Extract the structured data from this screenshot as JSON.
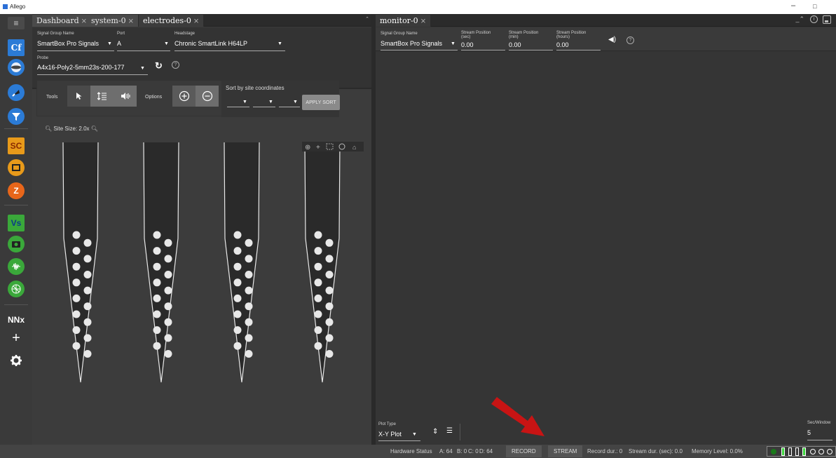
{
  "window": {
    "title": "Allego",
    "minimize": "–",
    "maximize": "□"
  },
  "launcher": {
    "items": [
      {
        "name": "cf",
        "label": "Cf",
        "color": "#2b7bd6"
      },
      {
        "name": "sphere",
        "label": "",
        "color": "#2b7bd6"
      },
      {
        "name": "rocket",
        "label": "",
        "color": "#2b7bd6"
      },
      {
        "name": "funnel",
        "label": "",
        "color": "#2b7bd6"
      },
      {
        "name": "sc",
        "label": "SC",
        "color": "#e89a1a"
      },
      {
        "name": "screen",
        "label": "",
        "color": "#e89a1a"
      },
      {
        "name": "z",
        "label": "Z",
        "color": "#e8661a"
      },
      {
        "name": "vs",
        "label": "Vs",
        "color": "#3aa83a"
      },
      {
        "name": "camera",
        "label": "",
        "color": "#3aa83a"
      },
      {
        "name": "wave",
        "label": "",
        "color": "#3aa83a"
      },
      {
        "name": "grid",
        "label": "",
        "color": "#3aa83a"
      },
      {
        "name": "nnx",
        "label": "NNx",
        "color": ""
      },
      {
        "name": "plus",
        "label": "+",
        "color": ""
      },
      {
        "name": "gear",
        "label": "",
        "color": ""
      }
    ]
  },
  "left_panel": {
    "tabs": [
      {
        "label": "Dashboard",
        "close": "×"
      },
      {
        "label": "system-0",
        "close": "×"
      },
      {
        "label": "electrodes-0",
        "close": "×"
      }
    ],
    "signal_group": {
      "label": "Signal Group Name",
      "value": "SmartBox Pro Signals"
    },
    "port": {
      "label": "Port",
      "value": "A"
    },
    "headstage": {
      "label": "Headstage",
      "value": "Chronic SmartLink H64LP"
    },
    "probe": {
      "label": "Probe",
      "value": "A4x16-Poly2-5mm23s-200-177"
    },
    "tools_label": "Tools",
    "options_label": "Options",
    "sort_label": "Sort by site coordinates",
    "apply_sort": "APPLY SORT",
    "site_size": "Site Size: 2.0x",
    "probes": {
      "shanks": 4,
      "sites_per_shank": 16
    }
  },
  "right_panel": {
    "tabs": [
      {
        "label": "monitor-0",
        "close": "×"
      }
    ],
    "signal_group": {
      "label": "Signal Group Name",
      "value": "SmartBox Pro Signals"
    },
    "stream_sec": {
      "label": "Stream Position (sec)",
      "value": "0.00"
    },
    "stream_min": {
      "label": "Stream Position (min)",
      "value": "0.00"
    },
    "stream_hours": {
      "label": "Stream Position (hours)",
      "value": "0.00"
    },
    "plot_type": {
      "label": "Plot Type",
      "value": "X-Y Plot"
    },
    "sec_window": {
      "label": "Sec/Window",
      "value": "5"
    }
  },
  "status_bar": {
    "hardware_status": "Hardware Status",
    "a": "A: 64",
    "b": "B: 0",
    "c": "C: 0",
    "d": "D: 64",
    "record": "RECORD",
    "stream": "STREAM",
    "record_dur": "Record dur.: 0",
    "stream_dur": "Stream dur. (sec): 0.0",
    "memory": "Memory Level: 0.0%"
  }
}
